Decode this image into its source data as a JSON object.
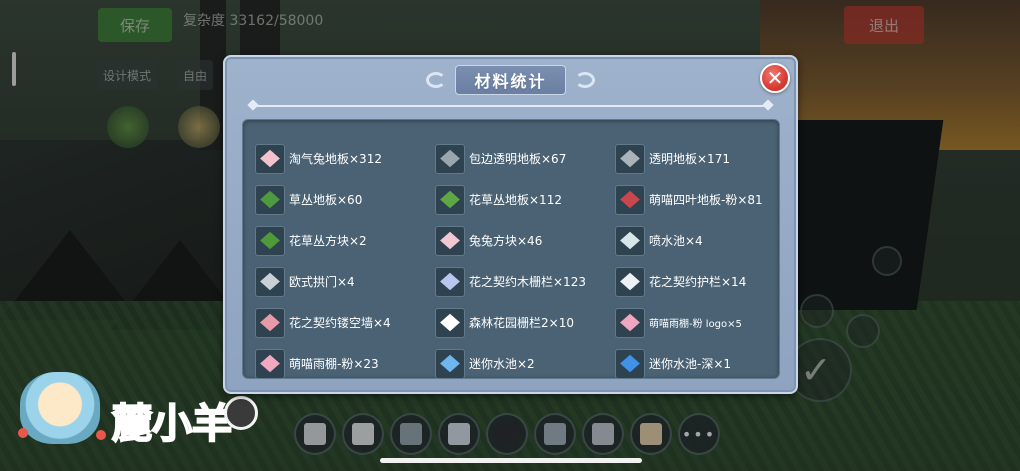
{
  "hud": {
    "save_label": "保存",
    "complexity_text": "复杂度 33162/58000",
    "exit_label": "退出",
    "mode_design": "设计模式",
    "mode_free": "自由"
  },
  "modal": {
    "title": "材料统计",
    "close_symbol": "✕",
    "items": [
      {
        "label": "淘气兔地板×312",
        "icon": "pink-floor-tile-icon",
        "color": "#f3c2cc"
      },
      {
        "label": "包边透明地板×67",
        "icon": "gray-transparent-floor-icon",
        "color": "#9aa6ad"
      },
      {
        "label": "透明地板×171",
        "icon": "transparent-floor-icon",
        "color": "#aab3b8"
      },
      {
        "label": "草丛地板×60",
        "icon": "grass-floor-icon",
        "color": "#4f9a3e"
      },
      {
        "label": "花草丛地板×112",
        "icon": "flower-grass-floor-icon",
        "color": "#5da845"
      },
      {
        "label": "萌喵四叶地板-粉×81",
        "icon": "clover-floor-pink-icon",
        "color": "#c9464f"
      },
      {
        "label": "花草丛方块×2",
        "icon": "flower-grass-block-icon",
        "color": "#4e9a3b"
      },
      {
        "label": "兔兔方块×46",
        "icon": "bunny-block-icon",
        "color": "#f0c7d2"
      },
      {
        "label": "喷水池×4",
        "icon": "fountain-icon",
        "color": "#d8e6ea"
      },
      {
        "label": "欧式拱门×4",
        "icon": "european-arch-icon",
        "color": "#c9d0d6"
      },
      {
        "label": "花之契约木栅栏×123",
        "icon": "flower-wood-fence-icon",
        "color": "#b8c6f0"
      },
      {
        "label": "花之契约护栏×14",
        "icon": "flower-guardrail-icon",
        "color": "#eef1f4"
      },
      {
        "label": "花之契约镂空墙×4",
        "icon": "hollow-wall-icon",
        "color": "#e99aa8"
      },
      {
        "label": "森林花园栅栏2×10",
        "icon": "forest-garden-fence-icon",
        "color": "#ffffff"
      },
      {
        "label": "萌喵雨棚-粉 logo×5",
        "icon": "awning-pink-logo-icon",
        "color": "#f0a6be"
      },
      {
        "label": "萌喵雨棚-粉×23",
        "icon": "awning-pink-icon",
        "color": "#f1a9c2"
      },
      {
        "label": "迷你水池×2",
        "icon": "mini-pool-icon",
        "color": "#6fb6ee"
      },
      {
        "label": "迷你水池-深×1",
        "icon": "mini-pool-deep-icon",
        "color": "#3f92e6"
      }
    ]
  },
  "watermark": {
    "text": "麓小羊"
  },
  "toolbar": {
    "more_label": "•••",
    "slots": [
      {
        "icon": "eraser-icon",
        "color": "#cfd3d6"
      },
      {
        "icon": "radiator-block-icon",
        "color": "#d9dddd"
      },
      {
        "icon": "arch-gate-icon",
        "color": "#8ea0a8"
      },
      {
        "icon": "window-frame-icon",
        "color": "#c9d3dd"
      },
      {
        "icon": "dark-panel-icon",
        "color": "#2b2f33"
      },
      {
        "icon": "column-block-icon",
        "color": "#9aaab6"
      },
      {
        "icon": "door-icon",
        "color": "#b8c0c8"
      },
      {
        "icon": "wardrobe-icon",
        "color": "#d8c6a4"
      }
    ]
  }
}
